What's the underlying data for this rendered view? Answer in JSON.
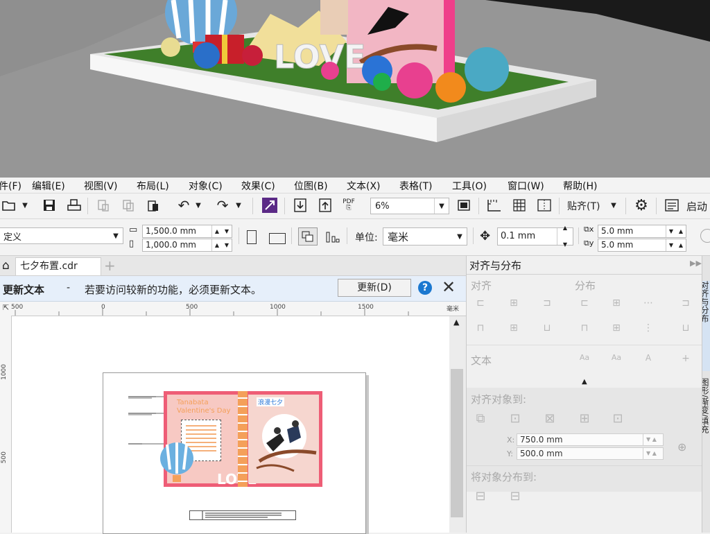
{
  "menubar": {
    "items": [
      "件(F)",
      "编辑(E)",
      "视图(V)",
      "布局(L)",
      "对象(C)",
      "效果(C)",
      "位图(B)",
      "文本(X)",
      "表格(T)",
      "工具(O)",
      "窗口(W)",
      "帮助(H)"
    ]
  },
  "toolbar": {
    "zoom_value": "6%",
    "snap_label": "贴齐(T)",
    "launch_label": "启动",
    "pdf_label": "PDF"
  },
  "propbar": {
    "preset_value": "定义",
    "width_value": "1,500.0 mm",
    "height_value": "1,000.0 mm",
    "units_label": "单位:",
    "units_value": "毫米",
    "nudge_value": "0.1 mm",
    "dup_x_value": "5.0 mm",
    "dup_y_value": "5.0 mm"
  },
  "tabs": {
    "doc_name": "七夕布置.cdr",
    "add_tab": "+"
  },
  "notice": {
    "title": "更新文本",
    "dash": "-",
    "message": "若要访问较新的功能，必须更新文本。",
    "update_label": "更新(D)",
    "help_label": "?"
  },
  "ruler": {
    "h_labels": [
      "500",
      "0",
      "500",
      "1000",
      "1500"
    ],
    "h_unit": "毫米",
    "v_labels": [
      "1000",
      "500"
    ]
  },
  "artwork": {
    "heading_line1": "Tanabata",
    "heading_line2": "Valentine's Day",
    "love_text": "LOVE",
    "badge_text": "浪漫七夕"
  },
  "docker": {
    "title": "对齐与分布",
    "align_label": "对齐",
    "distribute_label": "分布",
    "text_label": "文本",
    "align_to_label": "对齐对象到:",
    "x_label": "X:",
    "x_value": "750.0 mm",
    "y_label": "Y:",
    "y_value": "500.0 mm",
    "distribute_to_label": "将对象分布到:"
  },
  "side_tabs": [
    "对齐与分布",
    "图形/渐变/填充"
  ],
  "render": {
    "love_text": "LOVE"
  }
}
